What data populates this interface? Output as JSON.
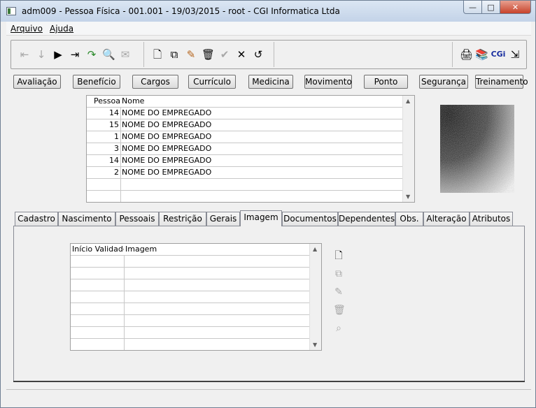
{
  "window": {
    "title": "adm009 - Pessoa Física - 001.001 - 19/03/2015 - root - CGI Informatica Ltda",
    "min": "—",
    "max": "□",
    "close": "✕"
  },
  "menu": [
    {
      "label": "Arquivo"
    },
    {
      "label": "Ajuda"
    }
  ],
  "toolbar": {
    "nav": [
      "⇤",
      "↓",
      "▶",
      "⇥",
      "↷",
      "🔍",
      "✉"
    ],
    "edit": [
      "🗋",
      "⧉",
      "✎",
      "🗑",
      "✔",
      "✕",
      "↺"
    ],
    "right": [
      "🖨",
      "📚",
      "CGi",
      "⇲"
    ]
  },
  "buttons": [
    "Avaliação",
    "Benefício",
    "Cargos",
    "Currículo",
    "Medicina",
    "Movimento",
    "Ponto",
    "Segurança",
    "Treinamento"
  ],
  "people_grid": {
    "headers": [
      "Pessoa",
      "Nome"
    ],
    "rows": [
      {
        "id": "14",
        "name": "NOME DO EMPREGADO"
      },
      {
        "id": "15",
        "name": "NOME DO EMPREGADO"
      },
      {
        "id": "1",
        "name": "NOME DO EMPREGADO"
      },
      {
        "id": "3",
        "name": "NOME DO EMPREGADO"
      },
      {
        "id": "14",
        "name": "NOME DO EMPREGADO"
      },
      {
        "id": "2",
        "name": "NOME DO EMPREGADO"
      }
    ]
  },
  "tabs": [
    "Cadastro",
    "Nascimento",
    "Pessoais",
    "Restrição",
    "Gerais",
    "Imagem",
    "Documentos",
    "Dependentes",
    "Obs.",
    "Alteração",
    "Atributos"
  ],
  "active_tab": "Imagem",
  "image_grid": {
    "headers": [
      "Início Validade",
      "Imagem"
    ]
  },
  "side_buttons": [
    "new-icon",
    "copy-icon",
    "edit-icon",
    "delete-icon",
    "search-icon"
  ]
}
